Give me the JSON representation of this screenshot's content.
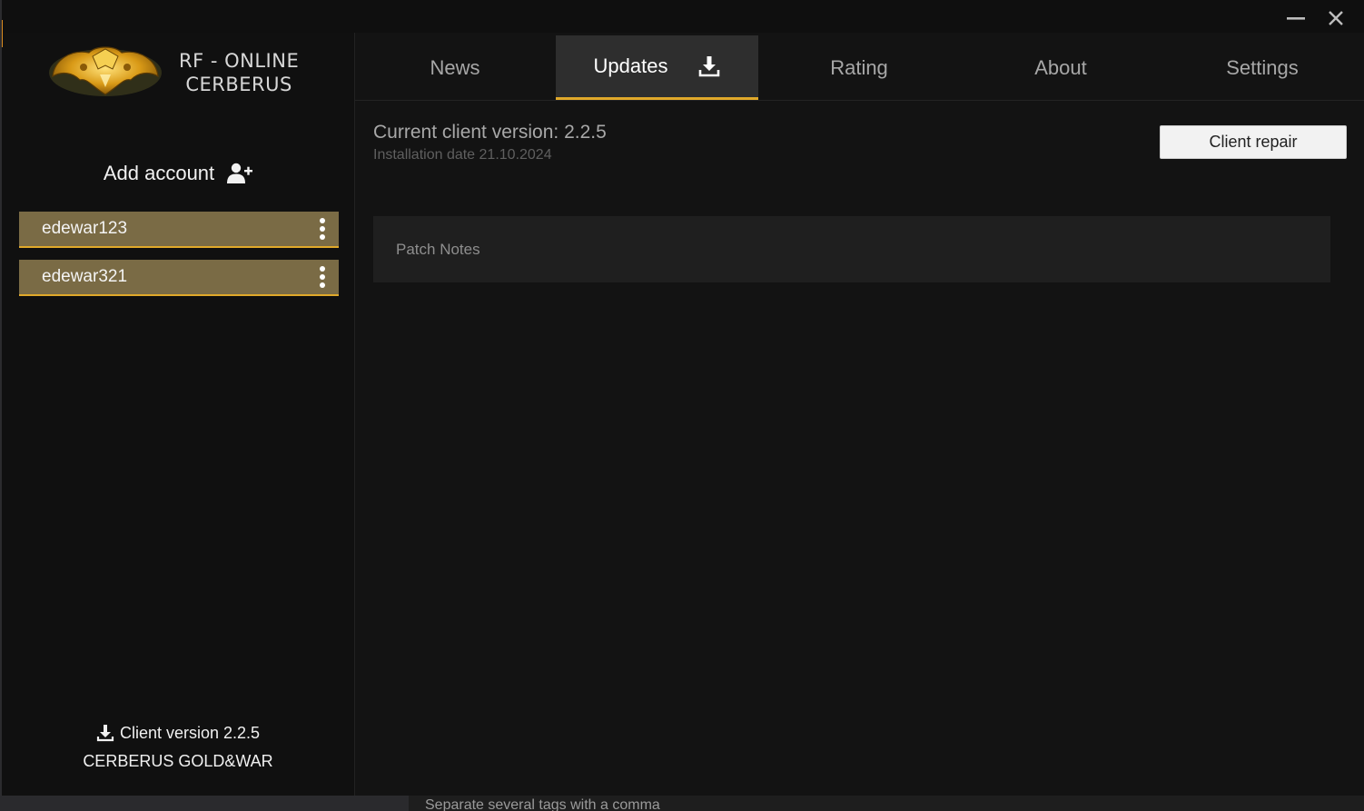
{
  "app": {
    "logo_text_line1": "RF - ONLINE",
    "logo_text_line2": "CERBERUS"
  },
  "window_controls": {
    "minimize": "minimize-icon",
    "close": "close-icon"
  },
  "nav": {
    "tabs": [
      {
        "label": "News",
        "active": false
      },
      {
        "label": "Updates",
        "active": true,
        "icon": "download-icon"
      },
      {
        "label": "Rating",
        "active": false
      },
      {
        "label": "About",
        "active": false
      },
      {
        "label": "Settings",
        "active": false
      }
    ]
  },
  "sidebar": {
    "add_account_label": "Add account",
    "add_account_icon": "add-user-icon",
    "accounts": [
      {
        "name": "edewar123"
      },
      {
        "name": "edewar321"
      }
    ],
    "client_version_label": "Client version 2.2.5",
    "server_name": "CERBERUS GOLD&WAR"
  },
  "main": {
    "current_version": "Current client version: 2.2.5",
    "installation_date": "Installation date 21.10.2024",
    "repair_button": "Client repair",
    "patch_notes_label": "Patch Notes"
  },
  "background": {
    "hint_text": "Separate several tags with a comma"
  },
  "colors": {
    "accent": "#e0a92a",
    "account_bg": "#7a6b45",
    "window_bg": "#131313",
    "active_tab_bg": "#2e2e2e"
  }
}
